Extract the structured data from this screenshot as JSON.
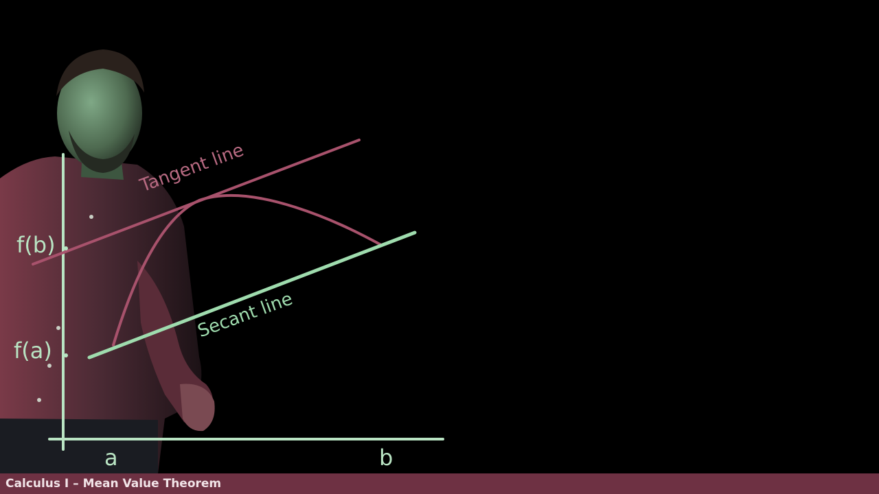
{
  "board": {
    "labels": {
      "f_of_b": "f(b)",
      "f_of_a": "f(a)",
      "a": "a",
      "b": "b",
      "tangent": "Tangent line",
      "secant": "Secant line"
    },
    "colors": {
      "axis": "#b9e4c3",
      "curve": "#a8526c",
      "tangent": "#a8526c",
      "secant": "#9fdcae",
      "background": "#000000"
    }
  },
  "banner": {
    "title": "Calculus I – Mean Value Theorem",
    "color": "#6e3143"
  }
}
